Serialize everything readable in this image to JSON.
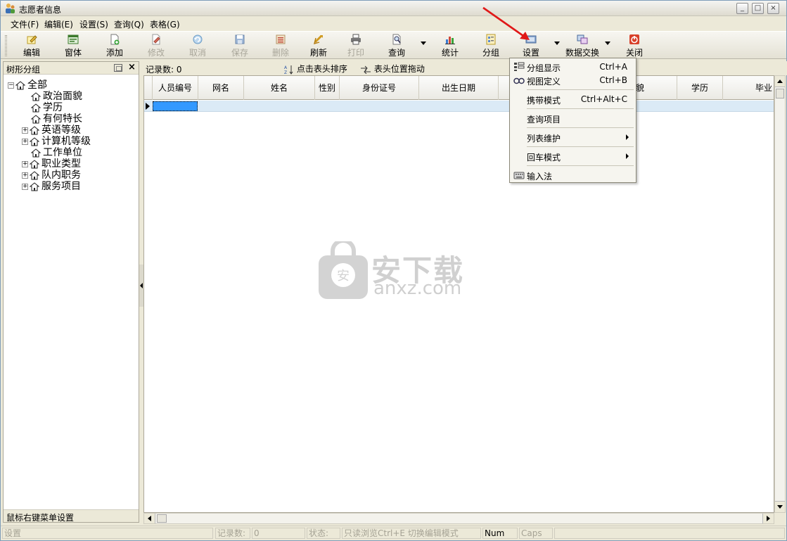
{
  "window": {
    "title": "志愿者信息",
    "minimize": "_",
    "maximize": "□",
    "close": "×"
  },
  "menubar": [
    "文件(F)",
    "编辑(E)",
    "设置(S)",
    "查询(Q)",
    "表格(G)"
  ],
  "toolbar": {
    "edit": "编辑",
    "form": "窗体",
    "add": "添加",
    "modify": "修改",
    "cancel": "取消",
    "save": "保存",
    "delete": "删除",
    "refresh": "刷新",
    "print": "打印",
    "query": "查询",
    "stats": "统计",
    "group": "分组",
    "settings": "设置",
    "exchange": "数据交换",
    "close": "关闭"
  },
  "left_panel": {
    "title": "树形分组",
    "close": "×",
    "footer": "鼠标右键菜单设置",
    "tree": [
      {
        "label": "全部",
        "expander": "−",
        "level": 0
      },
      {
        "label": "政治面貌",
        "expander": "",
        "level": 1
      },
      {
        "label": "学历",
        "expander": "",
        "level": 1
      },
      {
        "label": "有何特长",
        "expander": "",
        "level": 1
      },
      {
        "label": "英语等级",
        "expander": "+",
        "level": 1
      },
      {
        "label": "计算机等级",
        "expander": "+",
        "level": 1
      },
      {
        "label": "工作单位",
        "expander": "",
        "level": 1
      },
      {
        "label": "职业类型",
        "expander": "+",
        "level": 1
      },
      {
        "label": "队内职务",
        "expander": "+",
        "level": 1
      },
      {
        "label": "服务项目",
        "expander": "+",
        "level": 1
      }
    ]
  },
  "main": {
    "record_count": "记录数: 0",
    "sort_hint": "点击表头排序",
    "drag_hint": "表头位置拖动",
    "columns": [
      "人员编号",
      "网名",
      "姓名",
      "性别",
      "身份证号",
      "出生日期",
      "",
      "面貌",
      "学历",
      "毕业"
    ]
  },
  "dropdown": {
    "items": [
      {
        "label": "分组显示",
        "shortcut": "Ctrl+A",
        "icon": "group-display-icon"
      },
      {
        "label": "视图定义",
        "shortcut": "Ctrl+B",
        "icon": "view-define-icon"
      },
      {
        "label": "携带模式",
        "shortcut": "Ctrl+Alt+C"
      },
      {
        "label": "查询项目",
        "shortcut": ""
      },
      {
        "label": "列表维护",
        "shortcut": "",
        "submenu": true
      },
      {
        "label": "回车模式",
        "shortcut": "",
        "submenu": true
      },
      {
        "label": "输入法",
        "shortcut": "",
        "icon": "keyboard-icon"
      }
    ]
  },
  "watermark": {
    "text": "安下载",
    "url": "anxz.com"
  },
  "statusbar": {
    "left": "设置",
    "records_label": "记录数:",
    "records_value": "0",
    "state_label": "状态:",
    "state_value": "只读浏览Ctrl+E 切换编辑模式",
    "num": "Num",
    "caps": "Caps"
  }
}
